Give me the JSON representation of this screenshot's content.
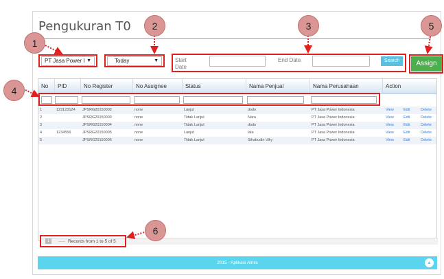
{
  "page": {
    "title": "Pengukuran T0"
  },
  "filters": {
    "company_select": "PT Jasa Power I",
    "period_select": "Today",
    "start_date_label": "Start Date",
    "end_date_label": "End Date",
    "search_button": "Search",
    "assign_button": "Assign"
  },
  "table": {
    "columns": [
      "No",
      "PID",
      "No Register",
      "No Assignee",
      "Status",
      "Nama Penjual",
      "Nama Perusahaan",
      "Action"
    ],
    "rows": [
      {
        "no": "1",
        "pid": "123123124",
        "reg": "JPSRG20150002",
        "assignee": "none",
        "status": "Lanjut",
        "penjual": "dodo",
        "perusahaan": "PT Jasa Power Indonesia"
      },
      {
        "no": "2",
        "pid": "",
        "reg": "JPSRG20150003",
        "assignee": "none",
        "status": "Tidak Lanjut",
        "penjual": "Nara",
        "perusahaan": "PT Jasa Power Indonesia"
      },
      {
        "no": "3",
        "pid": "",
        "reg": "JPSRG20150004",
        "assignee": "none",
        "status": "Tidak Lanjut",
        "penjual": "dodo",
        "perusahaan": "PT Jasa Power Indonesia"
      },
      {
        "no": "4",
        "pid": "1234556",
        "reg": "JPSRG20150005",
        "assignee": "none",
        "status": "Lanjut",
        "penjual": "lala",
        "perusahaan": "PT Jasa Power Indonesia"
      },
      {
        "no": "5",
        "pid": "",
        "reg": "JPSRG20150006",
        "assignee": "none",
        "status": "Tidak Lanjut",
        "penjual": "Sihabudin Viky",
        "perusahaan": "PT Jasa Power Indonesia"
      }
    ],
    "actions": {
      "view": "View",
      "edit": "Edit",
      "delete": "Delete"
    }
  },
  "pager": {
    "page": "1",
    "records": "Records from 1 to 5 of 5"
  },
  "footer": {
    "text": "2015 - Aplikasi Almis"
  },
  "callouts": [
    "1",
    "2",
    "3",
    "4",
    "5",
    "6"
  ],
  "icons": {
    "dropdown": "triangle-down",
    "scroll_top": "chevron-up-icon"
  },
  "colors": {
    "highlight": "#e0201e",
    "assign": "#4cae4c",
    "search": "#5bc0de",
    "footer": "#5bd5ee",
    "callout": "#d99694"
  }
}
